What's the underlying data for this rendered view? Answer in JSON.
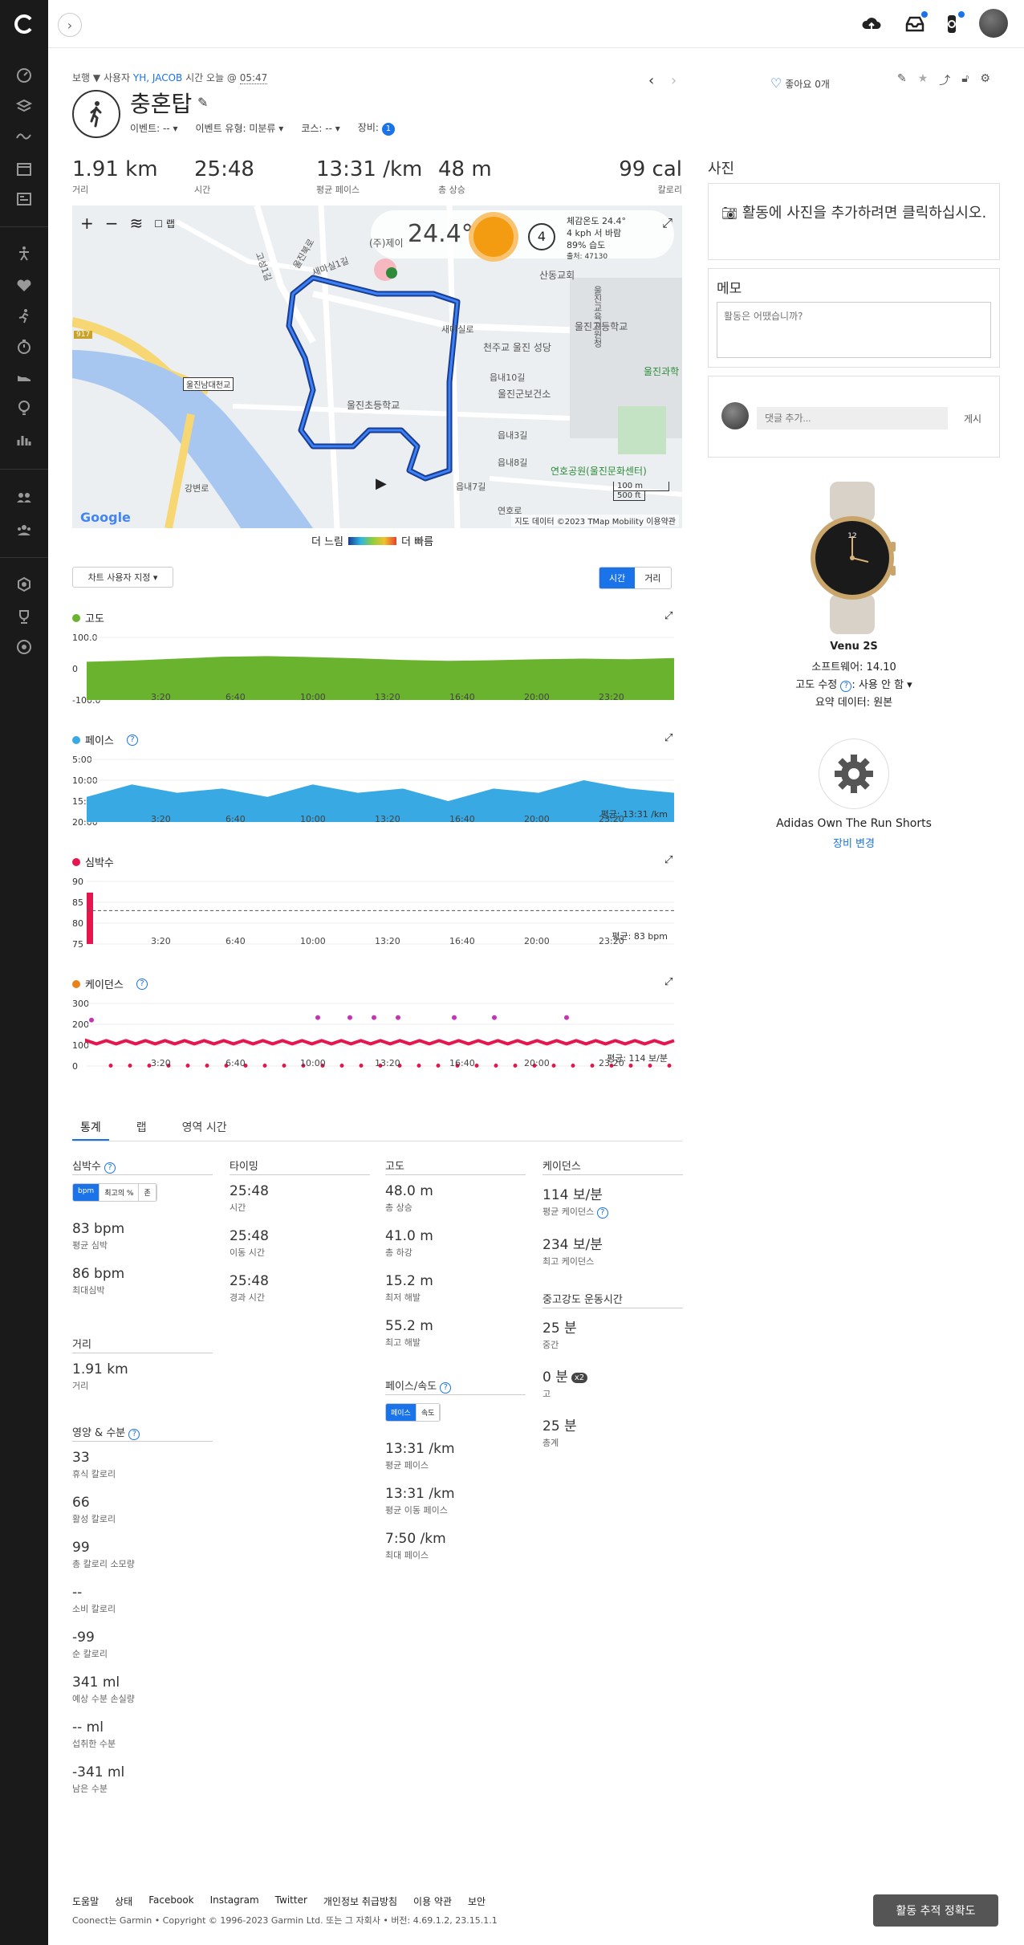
{
  "breadcrumb": {
    "visibility": "보행",
    "prefix": "사용자",
    "user": "YH, JACOB",
    "time_label": "시간 오늘 @",
    "time": "05:47"
  },
  "activity": {
    "title": "충혼탑",
    "event": "이벤트: --",
    "event_type": "이벤트 유형: 미분류",
    "course": "코스: --",
    "gear": "장비:",
    "gear_count": "1"
  },
  "like": {
    "label": "좋아요 0개"
  },
  "stats": [
    {
      "value": "1.91 km",
      "label": "거리"
    },
    {
      "value": "25:48",
      "label": "시간"
    },
    {
      "value": "13:31 /km",
      "label": "평균 페이스"
    },
    {
      "value": "48 m",
      "label": "총 상승"
    },
    {
      "value": "99 cal",
      "label": "칼로리"
    }
  ],
  "weather": {
    "temp": "24.4°",
    "feels": "체감온도 24.4°",
    "wind": "4 kph 서 바람",
    "humidity": "89% 습도",
    "station": "출처: 47130",
    "wind_speed": "4"
  },
  "map": {
    "labels": [
      "(주)제이",
      "산동교회",
      "천주교 울진 성당",
      "울진고등학교",
      "울진교육지원청",
      "울진초등학교",
      "읍내10길",
      "울진군보건소",
      "울진과학",
      "읍내3길",
      "읍내8길",
      "연호공원(울진문화센터)",
      "읍내7길",
      "연호로",
      "울진남대천교",
      "917",
      "울진북로",
      "고성1길",
      "새마실1길",
      "새마실로",
      "강변로"
    ],
    "credit": "지도 데이터 ©2023 TMap Mobility",
    "terms": "이용약관",
    "scale_m": "100 m",
    "scale_ft": "500 ft",
    "checkbox": "랩"
  },
  "speed_legend": {
    "slow": "더 느림",
    "fast": "더 빠름"
  },
  "chart_controls": {
    "customize": "차트 사용자 지정",
    "time": "시간",
    "distance": "거리"
  },
  "chart_data": [
    {
      "type": "area",
      "title": "고도",
      "x": [
        "3:20",
        "6:40",
        "10:00",
        "13:20",
        "16:40",
        "20:00",
        "23:20"
      ],
      "yticks": [
        "100.0",
        "0",
        "-100.0"
      ],
      "ylim": [
        -100,
        100
      ],
      "values": [
        22,
        26,
        32,
        38,
        40,
        37,
        33,
        28,
        25,
        27,
        30,
        32,
        30,
        34
      ],
      "color": "#6ab32e"
    },
    {
      "type": "area",
      "title": "페이스",
      "x": [
        "3:20",
        "6:40",
        "10:00",
        "13:20",
        "16:40",
        "20:00",
        "23:20"
      ],
      "yticks": [
        "5:00",
        "10:00",
        "15:00",
        "20:00"
      ],
      "ylim": [
        5,
        20
      ],
      "avg_label": "평균: 13:31 /km",
      "values": [
        14,
        11,
        13,
        12,
        14,
        11,
        13,
        12,
        15,
        12,
        13,
        10,
        12,
        13
      ],
      "color": "#38a9e2"
    },
    {
      "type": "line",
      "title": "심박수",
      "x": [
        "3:20",
        "6:40",
        "10:00",
        "13:20",
        "16:40",
        "20:00",
        "23:20"
      ],
      "yticks": [
        "90",
        "85",
        "80",
        "75"
      ],
      "ylim": [
        75,
        90
      ],
      "avg_label": "평균: 83 bpm",
      "color": "#e5164e"
    },
    {
      "type": "scatter",
      "title": "케이던스",
      "x": [
        "3:20",
        "6:40",
        "10:00",
        "13:20",
        "16:40",
        "20:00",
        "23:20"
      ],
      "yticks": [
        "300",
        "200",
        "100",
        "0"
      ],
      "ylim": [
        0,
        300
      ],
      "avg_label": "평균: 114 보/분",
      "color": "#e5164e"
    }
  ],
  "tabs": [
    "통계",
    "랩",
    "영역 시간"
  ],
  "heart": {
    "title": "심박수",
    "tog": [
      "bpm",
      "최고의 %",
      "존"
    ],
    "avg": "83 bpm",
    "avg_l": "평균 심박",
    "max": "86 bpm",
    "max_l": "최대심박"
  },
  "distance": {
    "title": "거리",
    "value": "1.91 km",
    "label": "거리"
  },
  "nutrition": {
    "title": "영양 & 수분",
    "items": [
      {
        "v": "33",
        "l": "휴식 칼로리"
      },
      {
        "v": "66",
        "l": "활성 칼로리"
      },
      {
        "v": "99",
        "l": "총 칼로리 소모량"
      },
      {
        "v": "--",
        "l": "소비 칼로리"
      },
      {
        "v": "-99",
        "l": "순 칼로리"
      },
      {
        "v": "341 ml",
        "l": "예상 수분 손실량"
      },
      {
        "v": "-- ml",
        "l": "섭취한 수분"
      },
      {
        "v": "-341 ml",
        "l": "남은 수분"
      }
    ]
  },
  "timing": {
    "title": "타이밍",
    "items": [
      {
        "v": "25:48",
        "l": "시간"
      },
      {
        "v": "25:48",
        "l": "이동 시간"
      },
      {
        "v": "25:48",
        "l": "경과 시간"
      }
    ]
  },
  "elevation": {
    "title": "고도",
    "items": [
      {
        "v": "48.0 m",
        "l": "총 상승"
      },
      {
        "v": "41.0 m",
        "l": "총 하강"
      },
      {
        "v": "15.2 m",
        "l": "최저 해발"
      },
      {
        "v": "55.2 m",
        "l": "최고 해발"
      }
    ]
  },
  "pace": {
    "title": "페이스/속도",
    "tog": [
      "페이스",
      "속도"
    ],
    "items": [
      {
        "v": "13:31 /km",
        "l": "평균 페이스"
      },
      {
        "v": "13:31 /km",
        "l": "평균 이동 페이스"
      },
      {
        "v": "7:50 /km",
        "l": "최대 페이스"
      }
    ]
  },
  "cadence": {
    "title": "케이던스",
    "items": [
      {
        "v": "114 보/분",
        "l": "평균 케이던스"
      },
      {
        "v": "234 보/분",
        "l": "최고 케이던스"
      }
    ]
  },
  "intensity": {
    "title": "중고강도 운동시간",
    "items": [
      {
        "v": "25 분",
        "l": "중간"
      },
      {
        "v": "0 분",
        "l": "고",
        "badge": "x2"
      },
      {
        "v": "25 분",
        "l": "총계"
      }
    ]
  },
  "right": {
    "photo_h": "사진",
    "photo_add": "활동에 사진을 추가하려면 클릭하십시오.",
    "memo_h": "메모",
    "memo_ph": "활동은 어땠습니까?",
    "comment_ph": "댓글 추가...",
    "post": "게시"
  },
  "device": {
    "name": "Venu 2S",
    "software": "소프트웨어: 14.10",
    "elev": "고도 수정",
    "elev_val": ": 사용 안 함",
    "summary": "요약 데이터: 원본"
  },
  "gear_item": {
    "name": "Adidas Own The Run Shorts",
    "change": "장비 변경"
  },
  "footer": {
    "links": [
      "도움말",
      "상태",
      "Facebook",
      "Instagram",
      "Twitter",
      "개인정보 취급방침",
      "이용 약관",
      "보안"
    ],
    "copyright": "Coonect는 Garmin • Copyright © 1996-2023 Garmin Ltd. 또는 그 자회사 • 버전: 4.69.1.2, 23.15.1.1",
    "accuracy": "활동 추적 정확도"
  }
}
